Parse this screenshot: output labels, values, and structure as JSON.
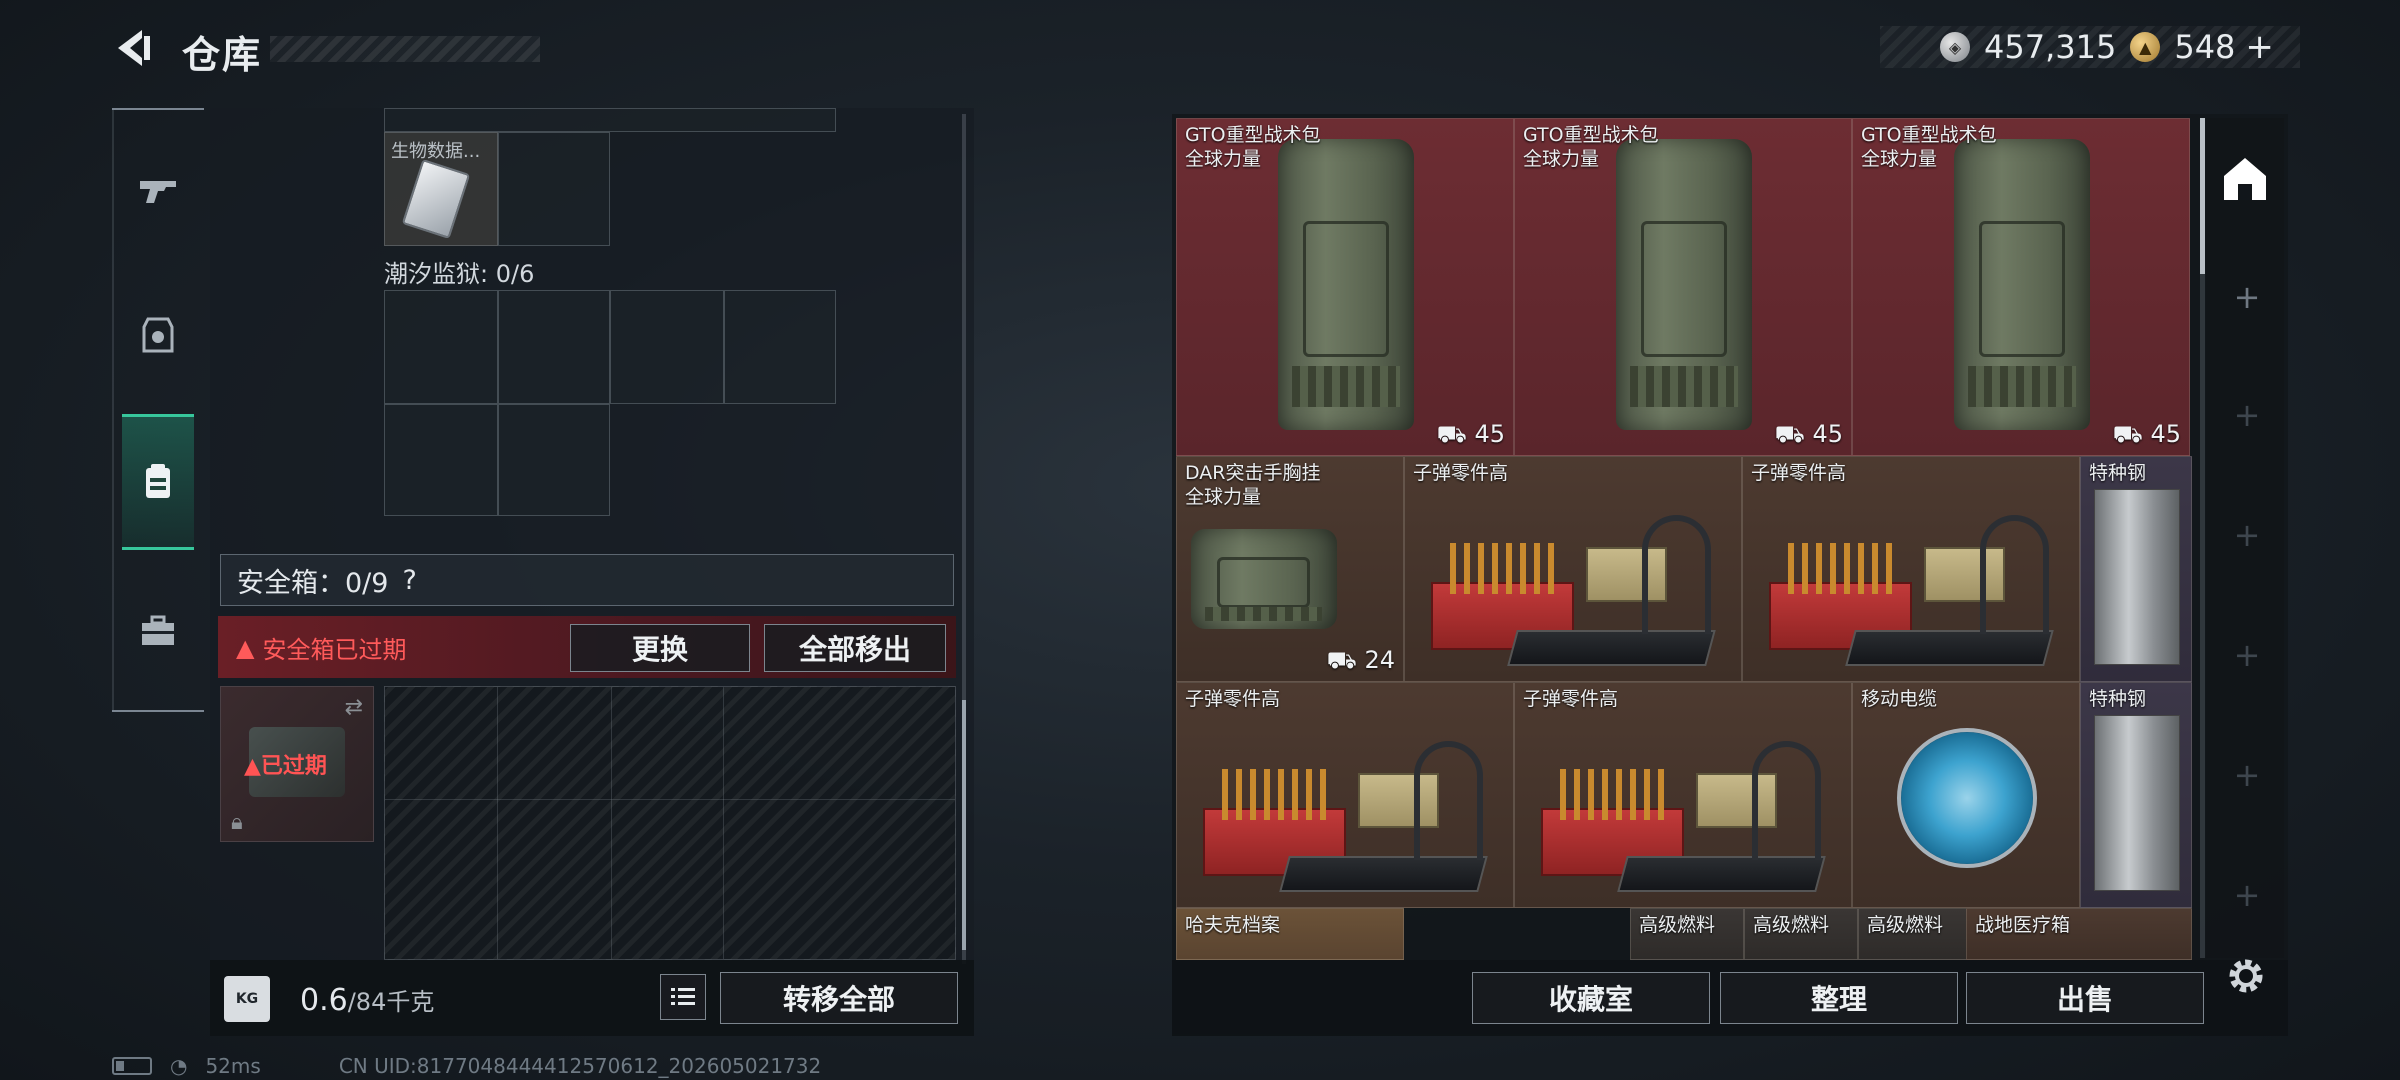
{
  "header": {
    "title": "仓库"
  },
  "currency": {
    "silver": "457,315",
    "gold": "548",
    "gold_plus": "+"
  },
  "left": {
    "item_top_label": "生物数据...",
    "section_label": "潮汐监狱: 0/6",
    "safe_header": "安全箱：0/9",
    "safe_help": "?",
    "expired_warning": "安全箱已过期",
    "replace_button": "更换",
    "move_all_out_button": "全部移出",
    "safe_slot_expired": "已过期",
    "weight_value": "0.6",
    "weight_max": "/84千克",
    "weight_icon_text": "KG",
    "transfer_all_button": "转移全部"
  },
  "stash": {
    "items": [
      {
        "name": "GTO重型战术包",
        "sub": "全球力量",
        "badge": "45",
        "bg": "red",
        "art": "pack"
      },
      {
        "name": "GTO重型战术包",
        "sub": "全球力量",
        "badge": "45",
        "bg": "red",
        "art": "pack"
      },
      {
        "name": "GTO重型战术包",
        "sub": "全球力量",
        "badge": "45",
        "bg": "red",
        "art": "pack"
      },
      {
        "name": "DAR突击手胸挂",
        "sub": "全球力量",
        "badge": "24",
        "bg": "brown",
        "art": "vest"
      },
      {
        "name": "子弹零件高",
        "sub": "",
        "badge": "",
        "bg": "brown",
        "art": "ammo"
      },
      {
        "name": "子弹零件高",
        "sub": "",
        "badge": "",
        "bg": "brown",
        "art": "ammo"
      },
      {
        "name": "特种钢",
        "sub": "",
        "badge": "",
        "bg": "purple",
        "art": "steel"
      },
      {
        "name": "子弹零件高",
        "sub": "",
        "badge": "",
        "bg": "brown",
        "art": "ammo"
      },
      {
        "name": "子弹零件高",
        "sub": "",
        "badge": "",
        "bg": "brown",
        "art": "ammo"
      },
      {
        "name": "移动电缆",
        "sub": "",
        "badge": "",
        "bg": "brown",
        "art": "reel"
      },
      {
        "name": "特种钢",
        "sub": "",
        "badge": "",
        "bg": "purple",
        "art": "steel"
      },
      {
        "name": "哈夫克档案",
        "sub": "",
        "badge": "",
        "bg": "gold",
        "art": "none"
      },
      {
        "name": "高级燃料",
        "sub": "",
        "badge": "",
        "bg": "grey",
        "art": "none"
      },
      {
        "name": "高级燃料",
        "sub": "",
        "badge": "",
        "bg": "grey",
        "art": "none"
      },
      {
        "name": "高级燃料",
        "sub": "",
        "badge": "",
        "bg": "grey",
        "art": "none"
      },
      {
        "name": "战地医疗箱",
        "sub": "",
        "badge": "",
        "bg": "brown",
        "art": "none"
      }
    ]
  },
  "footer_right": {
    "collection_button": "收藏室",
    "sort_button": "整理",
    "sell_button": "出售"
  },
  "status": {
    "ping": "52ms",
    "uid": "CN UID:8177048444412570612_202605021732"
  },
  "colors": {
    "accent": "#37c79c",
    "warning": "#ff5a5a",
    "rarity_red": "#6d2d33",
    "rarity_purple": "#3c3748",
    "rarity_gold": "#6b5238"
  }
}
